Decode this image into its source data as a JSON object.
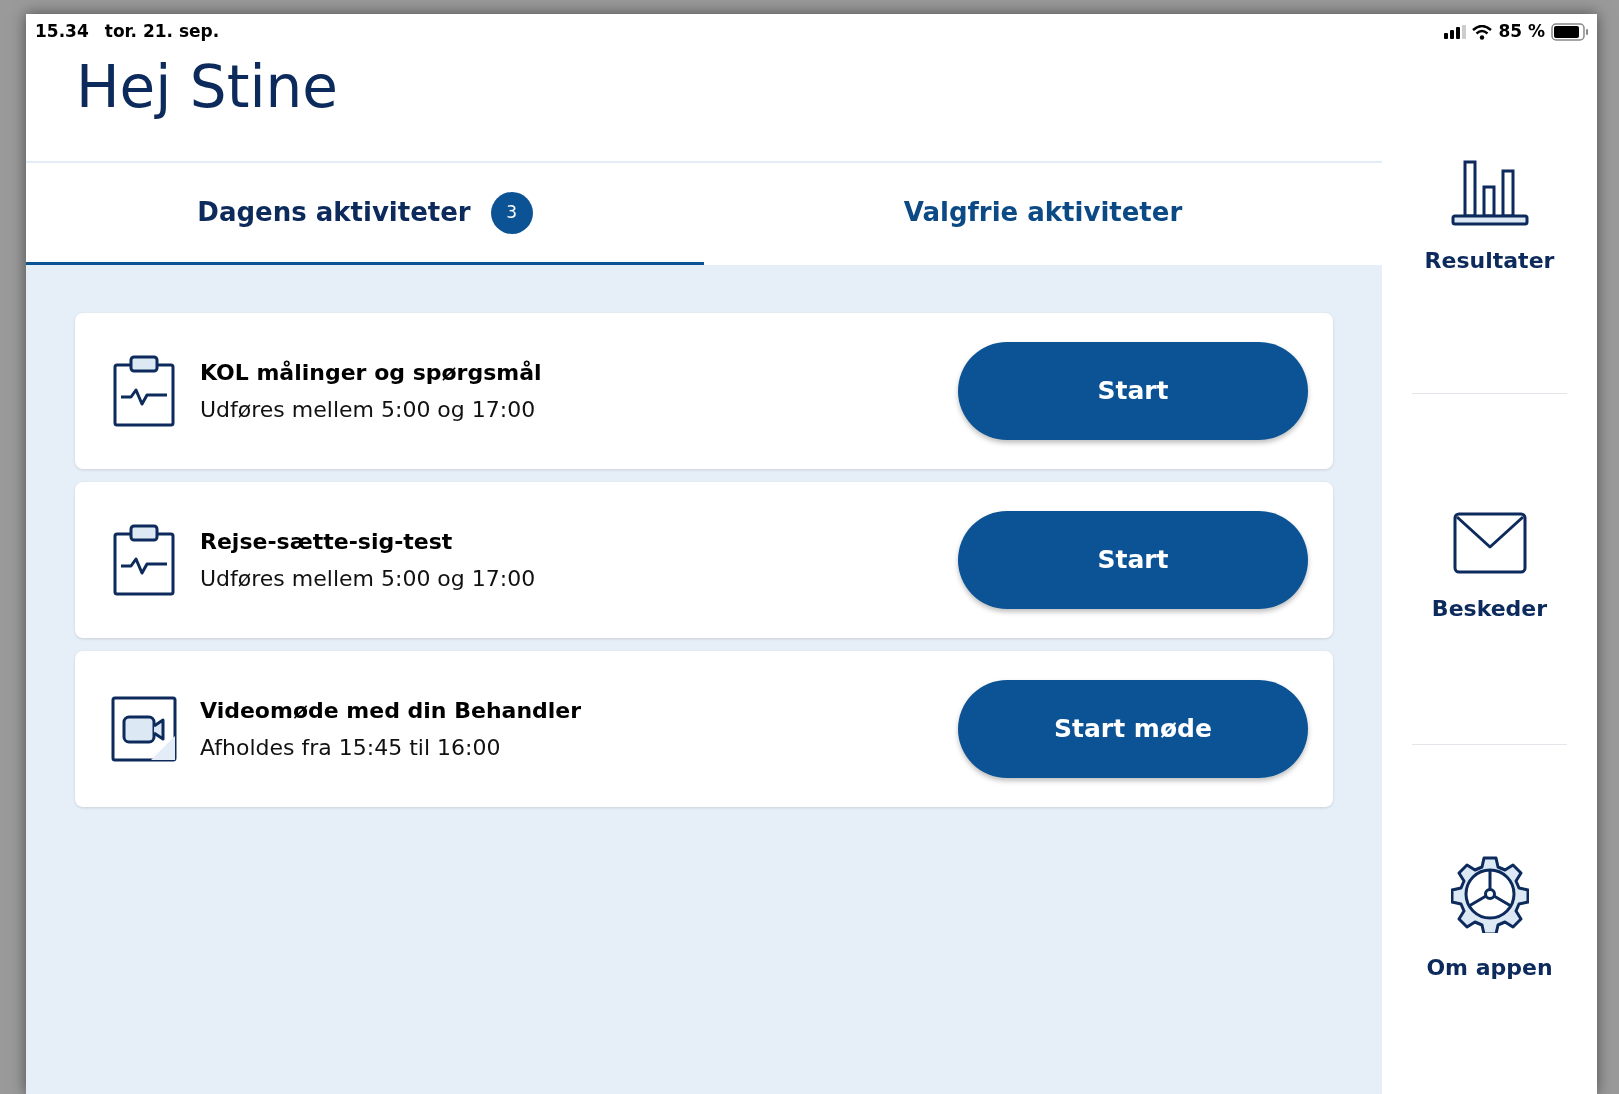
{
  "status_bar": {
    "time": "15.34",
    "date": "tor. 21. sep.",
    "battery": "85 %"
  },
  "greeting": "Hej Stine",
  "tabs": [
    {
      "label": "Dagens aktiviteter",
      "badge": "3",
      "selected": true
    },
    {
      "label": "Valgfrie aktiviteter",
      "selected": false
    }
  ],
  "activities": [
    {
      "kind": "clipboard",
      "title": "KOL målinger og spørgsmål",
      "subtitle": "Udføres mellem 5:00 og 17:00",
      "button": "Start"
    },
    {
      "kind": "clipboard",
      "title": "Rejse-sætte-sig-test",
      "subtitle": "Udføres mellem 5:00 og 17:00",
      "button": "Start"
    },
    {
      "kind": "video",
      "title": "Videomøde med din Behandler",
      "subtitle": "Afholdes fra 15:45 til 16:00",
      "button": "Start møde"
    }
  ],
  "sidebar": {
    "items": [
      {
        "kind": "chart",
        "label": "Resultater"
      },
      {
        "kind": "mail",
        "label": "Beskeder"
      },
      {
        "kind": "gear",
        "label": "Om appen"
      }
    ]
  }
}
